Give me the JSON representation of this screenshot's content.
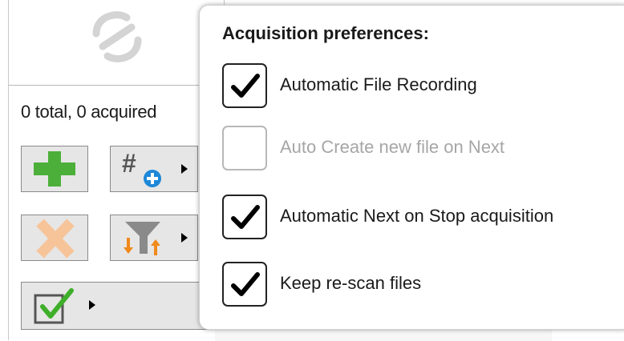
{
  "left_panel": {
    "summary": "0 total, 0 acquired",
    "buttons": [
      {
        "name": "add",
        "icon": "plus-icon"
      },
      {
        "name": "add-numbered",
        "icon": "hash-plus-icon"
      },
      {
        "name": "delete",
        "icon": "x-icon"
      },
      {
        "name": "filter-sort",
        "icon": "filter-sort-icon"
      },
      {
        "name": "check",
        "icon": "checkbox-check-icon"
      }
    ]
  },
  "popup": {
    "title": "Acquisition preferences:",
    "options": [
      {
        "label": "Automatic File Recording",
        "checked": true,
        "enabled": true
      },
      {
        "label": "Auto Create new file on Next",
        "checked": false,
        "enabled": false
      },
      {
        "label": "Automatic Next on Stop acquisition",
        "checked": true,
        "enabled": true
      },
      {
        "label": "Keep re-scan files",
        "checked": true,
        "enabled": true
      }
    ]
  },
  "colors": {
    "add_green": "#4caf3a",
    "delete_orange": "#f7c49a",
    "badge_blue": "#1e88d8",
    "filter_arrow_orange": "#f08a1c",
    "check_green": "#3fae2a",
    "disabled_text": "#a6a6a6"
  }
}
